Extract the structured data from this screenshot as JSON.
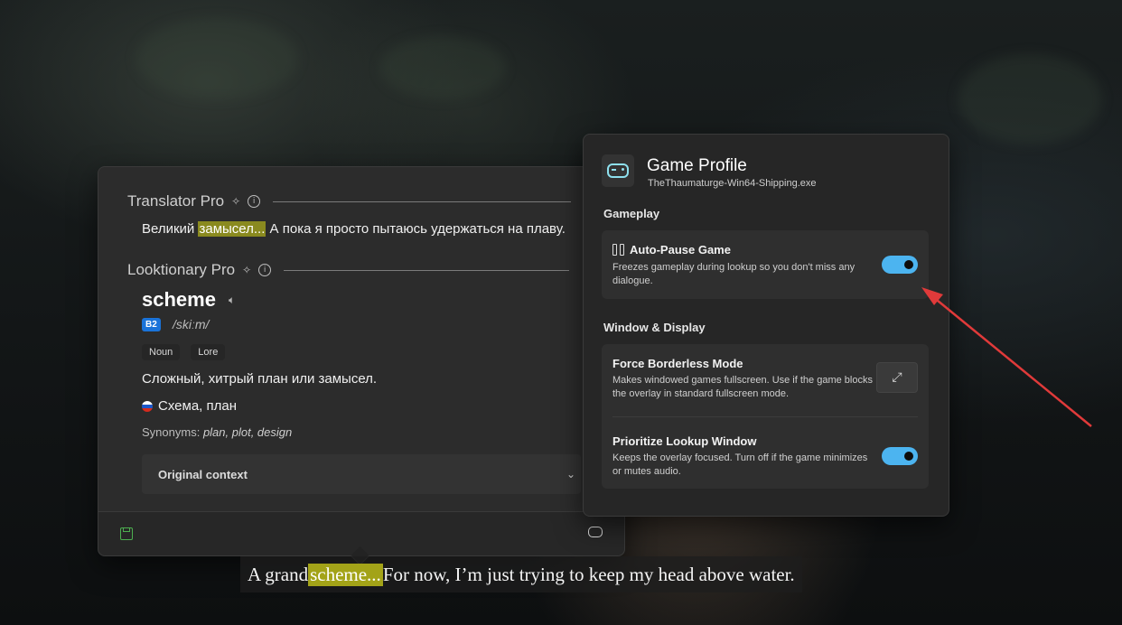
{
  "translator": {
    "title": "Translator Pro",
    "text_before": "Великий ",
    "text_highlight": "замысел...",
    "text_after": " А пока я просто пытаюсь удержаться на плаву."
  },
  "looktionary": {
    "title": "Looktionary Pro",
    "word": "scheme",
    "level": "B2",
    "ipa": "/skiːm/",
    "tags": [
      "Noun",
      "Lore"
    ],
    "definition": "Сложный, хитрый план или замысел.",
    "translation": "Схема, план",
    "synonyms_label": "Synonyms:",
    "synonyms": "plan, plot, design",
    "context_label": "Original context"
  },
  "profile": {
    "title": "Game Profile",
    "exe": "TheThaumaturge-Win64-Shipping.exe",
    "gameplay_label": "Gameplay",
    "window_label": "Window & Display",
    "auto_pause": {
      "name": "Auto-Pause Game",
      "desc": "Freezes gameplay during lookup so you don't miss any dialogue.",
      "enabled": true
    },
    "borderless": {
      "name": "Force Borderless Mode",
      "desc": "Makes windowed games fullscreen. Use if the game blocks the overlay in standard fullscreen mode."
    },
    "prioritize": {
      "name": "Prioritize Lookup Window",
      "desc": "Keeps the overlay focused. Turn off if the game minimizes or mutes audio.",
      "enabled": true
    }
  },
  "subtitle": {
    "before": "A grand ",
    "highlight": "scheme...",
    "after": " For now, I’m just trying to keep my head above water."
  },
  "colors": {
    "accent": "#4cb4f0",
    "highlight": "#a3a318",
    "arrow": "#e03a3a",
    "level_badge": "#1a73d9"
  }
}
